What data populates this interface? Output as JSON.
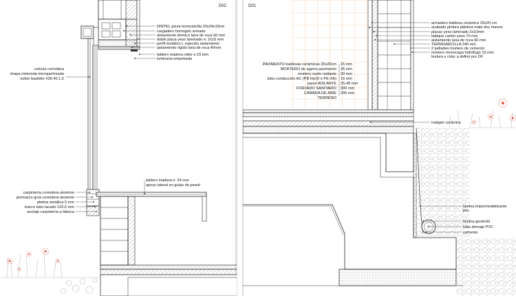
{
  "d02": {
    "tag": "D02",
    "labels_right": [
      "DINTEL pieza termoarcilla 20x24x19cm",
      "cargadero hormigón armado",
      "aislamiento térmico lana de roca 60 mm",
      "doble placa yeso laminado e: 2x10 mm",
      "perfil metálico L sujeción aislamiento",
      "aislamiento rígido lana de roca 40mm",
      "tablero madera roble e:19 mm",
      "luminaria empotrada"
    ],
    "labels_left_top": [
      "celosía corredera",
      "chapa  minionda microperforada",
      "sobre bastidor #30.40.1,5"
    ],
    "labels_mid": [
      "tablero madera e: 24 mm",
      "apoyo lateral en guías de pared"
    ],
    "labels_left_bottom": [
      "carpintería corredera aluminio",
      "premarco guía corredera aluminio",
      "pletina metálica 5 mm",
      "marco tubo lacado 120.6 mm",
      "anclaje carpintería a fábrica"
    ]
  },
  "d01": {
    "tag": "D01",
    "labels_right_top": [
      "armadero baldosa cerámica 20x20 cm",
      "acabado pintura plástica mate dos manos",
      "placas yeso laminado 2x10mm",
      "tabique cartón yeso 70 mm",
      "aislamiento lana de roca 60 mm",
      "TERMOARCILLA 240 mm",
      "2 pellades mortero de cemento",
      "mortero monocapa hidrófugo 15 mm",
      "textura y color a definir por DF"
    ],
    "floor_layers": [
      {
        "name": "PAVIMENTO baldosas cerámicas 20x20cm",
        "thickness": "15 mm"
      },
      {
        "name": "MORTERO de agarre pavimento",
        "thickness": "35 mm"
      },
      {
        "name": "mortero suelo radiante",
        "thickness": "30 mm"
      },
      {
        "name": "tubo conducción AC (PB He20 o PE-XA)",
        "thickness": "16 mm"
      },
      {
        "name": "panel AISLANTE",
        "thickness": "25-45 mm"
      },
      {
        "name": "FORJADO SANITARIO",
        "thickness": "300 mm"
      },
      {
        "name": "CÁMARA DE AIRE",
        "thickness": "300 mm"
      },
      {
        "name": "TERRENO",
        "thickness": ""
      }
    ],
    "skirting_label": "rodapié cerámico",
    "labels_right_bottom": [
      "lámina impermeabilizante",
      "pvc",
      "lámina geotextil",
      "tubo drenaje PVC",
      "cemento"
    ]
  },
  "colors": {
    "line": "#222222",
    "leader": "#444444",
    "grid_orange": "#f2b27a",
    "flower_red": "#e05a4e",
    "flower_ring": "#f5b7b0",
    "grass": "#b5b5b5"
  }
}
